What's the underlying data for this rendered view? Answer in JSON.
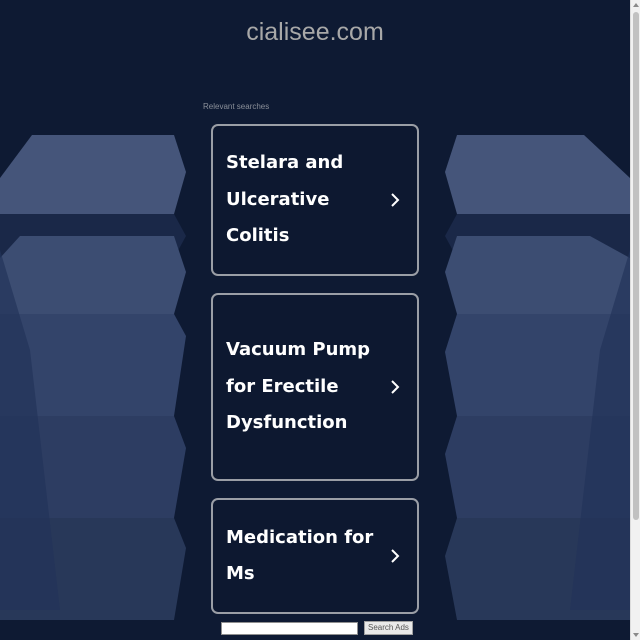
{
  "header": {
    "domain": "cialisee.com"
  },
  "relevant_searches": {
    "label": "Relevant searches",
    "items": [
      {
        "label": "Stelara and Ulcerative Colitis"
      },
      {
        "label": "Vacuum Pump for Erectile Dysfunction"
      },
      {
        "label": "Medication for Ms"
      }
    ]
  },
  "search_bar": {
    "placeholder": "",
    "button_label": "Search Ads"
  },
  "colors": {
    "background": "#0e1a33",
    "card_border": "#9a9ea6",
    "card_text": "#ffffff",
    "decor_shape": "#4a5a7e"
  },
  "icons": {
    "card_chevron": "chevron-right-icon",
    "scroll_up": "arrow-up-icon",
    "scroll_down": "arrow-down-icon"
  }
}
